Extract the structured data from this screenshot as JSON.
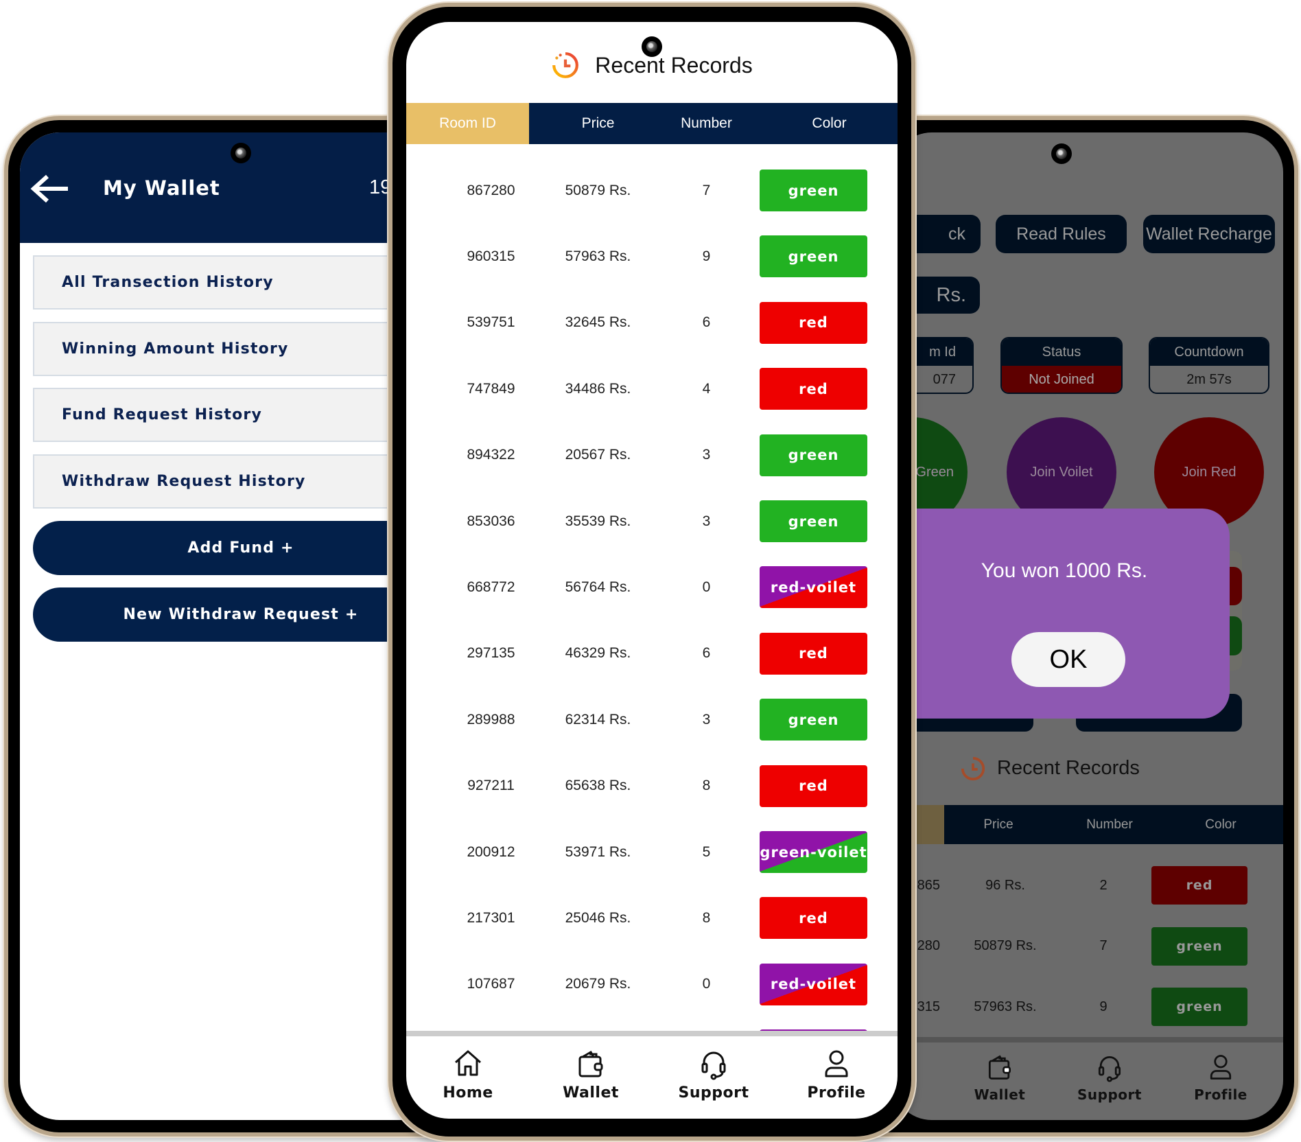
{
  "colors": {
    "navy": "#031e45",
    "gold": "#e8bf67",
    "green": "#22b222",
    "red": "#ee0000",
    "violet": "#9013a8",
    "dialog": "#8e58b2"
  },
  "wallet_screen": {
    "back_icon": "arrow-left-icon",
    "title": "My Wallet",
    "balance_partial": "19",
    "menu": [
      {
        "label": "All Transection History"
      },
      {
        "label": "Winning Amount History"
      },
      {
        "label": "Fund Request History"
      },
      {
        "label": "Withdraw Request History"
      }
    ],
    "buttons": [
      {
        "label": "Add Fund +"
      },
      {
        "label": "New Withdraw Request +"
      }
    ]
  },
  "records_screen": {
    "title": "Recent Records",
    "title_icon": "clock-history-icon",
    "columns": [
      "Room ID",
      "Price",
      "Number",
      "Color"
    ],
    "rows": [
      {
        "room_id": "867280",
        "price": "50879 Rs.",
        "number": "7",
        "color": "green"
      },
      {
        "room_id": "960315",
        "price": "57963 Rs.",
        "number": "9",
        "color": "green"
      },
      {
        "room_id": "539751",
        "price": "32645 Rs.",
        "number": "6",
        "color": "red"
      },
      {
        "room_id": "747849",
        "price": "34486 Rs.",
        "number": "4",
        "color": "red"
      },
      {
        "room_id": "894322",
        "price": "20567 Rs.",
        "number": "3",
        "color": "green"
      },
      {
        "room_id": "853036",
        "price": "35539 Rs.",
        "number": "3",
        "color": "green"
      },
      {
        "room_id": "668772",
        "price": "56764 Rs.",
        "number": "0",
        "color": "red-voilet"
      },
      {
        "room_id": "297135",
        "price": "46329 Rs.",
        "number": "6",
        "color": "red"
      },
      {
        "room_id": "289988",
        "price": "62314 Rs.",
        "number": "3",
        "color": "green"
      },
      {
        "room_id": "927211",
        "price": "65638 Rs.",
        "number": "8",
        "color": "red"
      },
      {
        "room_id": "200912",
        "price": "53971 Rs.",
        "number": "5",
        "color": "green-voilet"
      },
      {
        "room_id": "217301",
        "price": "25046 Rs.",
        "number": "8",
        "color": "red"
      },
      {
        "room_id": "107687",
        "price": "20679 Rs.",
        "number": "0",
        "color": "red-voilet"
      }
    ],
    "nav": [
      {
        "label": "Home",
        "icon": "home-icon"
      },
      {
        "label": "Wallet",
        "icon": "wallet-icon"
      },
      {
        "label": "Support",
        "icon": "headset-icon"
      },
      {
        "label": "Profile",
        "icon": "user-icon"
      }
    ]
  },
  "game_screen": {
    "top_buttons": [
      "ck",
      "Read Rules",
      "Wallet Recharge"
    ],
    "balance_partial": "Rs.",
    "cards": [
      {
        "label": "m Id",
        "value": "077"
      },
      {
        "label": "Status",
        "value": "Not Joined"
      },
      {
        "label": "Countdown",
        "value": "2m 57s"
      }
    ],
    "join_buttons": [
      "Green",
      "Join Voilet",
      "Join Red"
    ],
    "dialog": {
      "message": "You won 1000 Rs.",
      "ok": "OK"
    },
    "records_title": "Recent Records",
    "columns": [
      "Price",
      "Number",
      "Color"
    ],
    "rows": [
      {
        "room_id": "865",
        "price": "96 Rs.",
        "number": "2",
        "color": "red"
      },
      {
        "room_id": "280",
        "price": "50879 Rs.",
        "number": "7",
        "color": "green"
      },
      {
        "room_id": "315",
        "price": "57963 Rs.",
        "number": "9",
        "color": "green"
      }
    ],
    "nav": [
      {
        "label": "Wallet"
      },
      {
        "label": "Support"
      },
      {
        "label": "Profile"
      }
    ]
  }
}
